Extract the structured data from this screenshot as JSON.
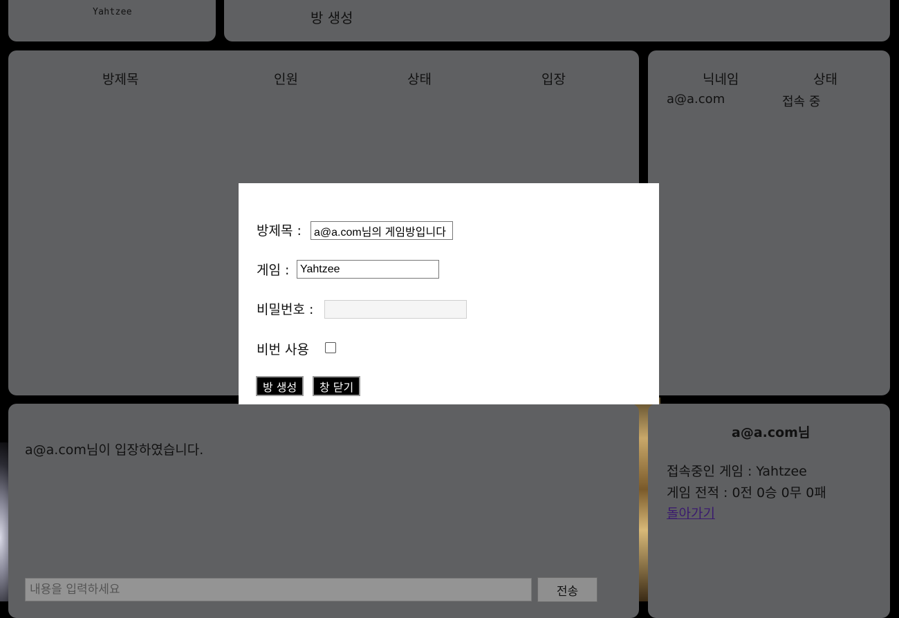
{
  "header": {
    "logo": "Yahtzee",
    "create_room": "방 생성"
  },
  "room_list": {
    "columns": [
      "방제목",
      "인원",
      "상태",
      "입장"
    ],
    "rows": []
  },
  "user_list": {
    "columns": [
      "닉네임",
      "상태"
    ],
    "rows": [
      {
        "nickname": "a@a.com",
        "status": "접속 중"
      }
    ]
  },
  "chat": {
    "messages": [
      "a@a.com님이 입장하였습니다."
    ],
    "input_placeholder": "내용을 입력하세요",
    "send_label": "전송"
  },
  "profile": {
    "name": "a@a.com님",
    "current_game": "접속중인 게임 : Yahtzee",
    "record": "게임 전적 : 0전 0승 0무 0패",
    "back_label": "돌아가기"
  },
  "modal": {
    "title_label": "방제목 :",
    "title_value": "a@a.com님의 게임방입니다",
    "game_label": "게임 :",
    "game_value": "Yahtzee",
    "password_label": "비밀번호 :",
    "password_value": "",
    "use_password_label": "비번 사용",
    "use_password_checked": false,
    "create_button": "방 생성",
    "close_button": "창 닫기"
  }
}
